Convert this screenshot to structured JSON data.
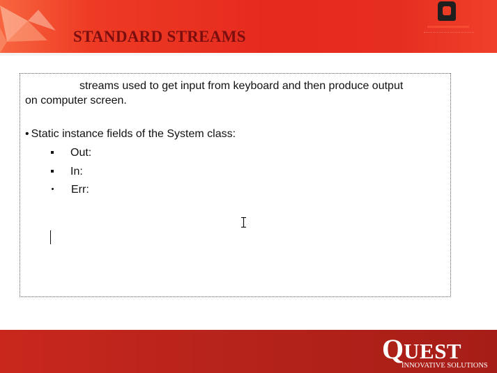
{
  "slide": {
    "title": "STANDARD STREAMS",
    "intro_line1": "streams used to get input from keyboard and then produce output",
    "intro_line2": "on computer screen.",
    "bullet": {
      "marker": "•",
      "text": "Static instance fields of the System class:"
    },
    "sub_items": [
      {
        "marker": "square",
        "label": "Out:"
      },
      {
        "marker": "square",
        "label": "In:"
      },
      {
        "marker": "dot",
        "label": "Err:"
      }
    ]
  },
  "footer": {
    "brand_first": "Q",
    "brand_rest": "UEST",
    "brand_sub": "INNOVATIVE SOLUTIONS"
  },
  "colors": {
    "header_red": "#e52a1e",
    "title_maroon": "#7b0f0f",
    "footer_red": "#b8241b"
  },
  "icons": {
    "header_left": "origami-bird-icon",
    "header_right": "brand-logo-icon",
    "cursor": "text-cursor-icon"
  }
}
